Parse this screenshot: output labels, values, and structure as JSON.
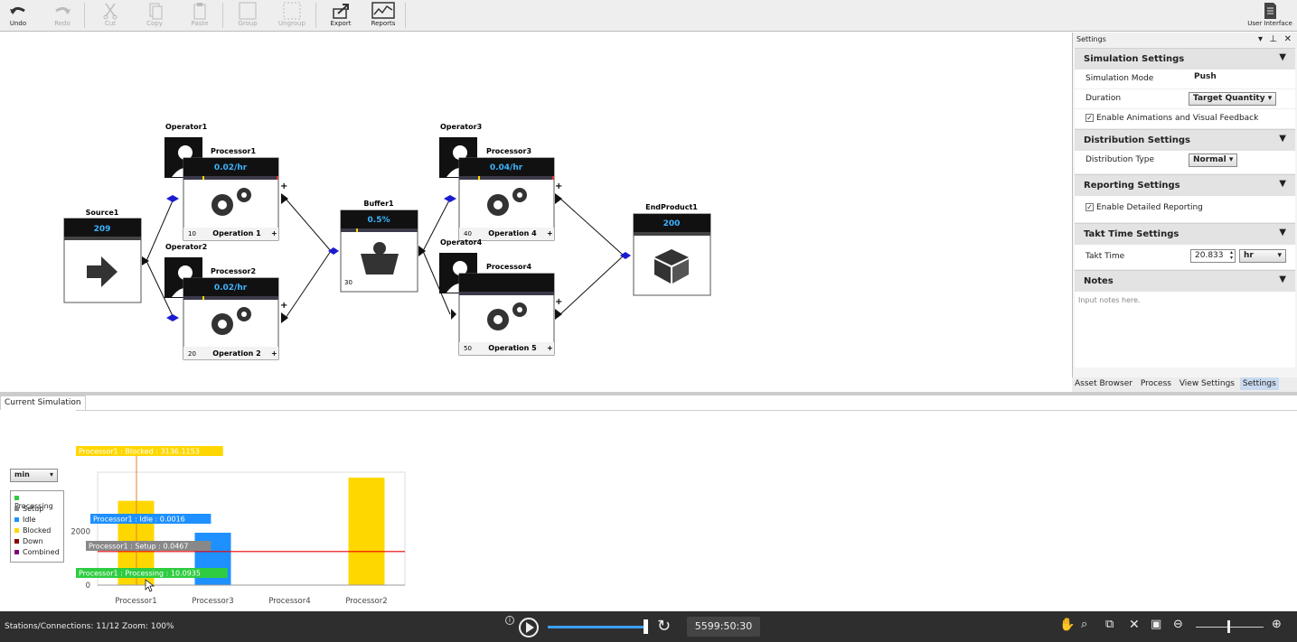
{
  "toolbar": {
    "undo": "Undo",
    "redo": "Redo",
    "cut": "Cut",
    "copy": "Copy",
    "paste": "Paste",
    "group": "Group",
    "ungroup": "Ungroup",
    "export": "Export",
    "reports": "Reports",
    "user_interface": "User Interface"
  },
  "canvas": {
    "source": {
      "name": "Source1",
      "value": "209"
    },
    "operator1": "Operator1",
    "operator2": "Operator2",
    "operator3": "Operator3",
    "operator4": "Operator4",
    "processor1": {
      "name": "Processor1",
      "rate": "0.02/hr",
      "count": "10",
      "op": "Operation 1"
    },
    "processor2": {
      "name": "Processor2",
      "rate": "0.02/hr",
      "count": "20",
      "op": "Operation 2"
    },
    "processor3": {
      "name": "Processor3",
      "rate": "0.04/hr",
      "count": "40",
      "op": "Operation 4"
    },
    "processor4": {
      "name": "Processor4",
      "rate": "",
      "count": "50",
      "op": "Operation 5"
    },
    "buffer": {
      "name": "Buffer1",
      "value": "0.5%",
      "count": "30"
    },
    "endproduct": {
      "name": "EndProduct1",
      "value": "200"
    },
    "plus": "+"
  },
  "settings": {
    "panel_title": "Settings",
    "simulation": {
      "title": "Simulation Settings",
      "mode_label": "Simulation Mode",
      "mode_value": "Push",
      "duration_label": "Duration",
      "duration_value": "Target Quantity",
      "anim_label": "Enable Animations and Visual Feedback"
    },
    "distribution": {
      "title": "Distribution Settings",
      "type_label": "Distribution Type",
      "type_value": "Normal"
    },
    "reporting": {
      "title": "Reporting Settings",
      "detail_label": "Enable Detailed Reporting"
    },
    "takt": {
      "title": "Takt Time Settings",
      "label": "Takt Time",
      "value": "20.833",
      "unit": "hr"
    },
    "notes": {
      "title": "Notes",
      "placeholder": "Input notes here."
    }
  },
  "panel_tabs": [
    "Asset Browser",
    "Process",
    "View Settings",
    "Settings"
  ],
  "bottom": {
    "tab": "Current Simulation",
    "unit_select": "min",
    "legend": [
      {
        "label": "Processing",
        "color": "#2ecc40"
      },
      {
        "label": "Setup",
        "color": "#888888"
      },
      {
        "label": "Idle",
        "color": "#1e90ff"
      },
      {
        "label": "Blocked",
        "color": "#ffd700"
      },
      {
        "label": "Down",
        "color": "#8b0000"
      },
      {
        "label": "Combined",
        "color": "#800080"
      }
    ],
    "tooltips": {
      "blocked": "Processor1 : Blocked : 3136.1153",
      "idle": "Processor1 : Idle : 0.0016",
      "setup": "Processor1 : Setup : 0.0467",
      "processing": "Processor1 : Processing : 10.0935"
    }
  },
  "chart_data": {
    "type": "bar",
    "categories": [
      "Processor1",
      "Processor3",
      "Processor4",
      "Processor2"
    ],
    "series": [
      {
        "name": "Blocked",
        "color": "#ffd700",
        "values": [
          3136.1153,
          0,
          0,
          4000
        ]
      },
      {
        "name": "Idle",
        "color": "#1e90ff",
        "values": [
          0.0016,
          1950,
          0,
          0
        ]
      }
    ],
    "yticks": [
      "0",
      "2000"
    ],
    "ylim": [
      0,
      4200
    ],
    "takt_line": 1250
  },
  "status": {
    "left": "Stations/Connections: 11/12  Zoom: 100%",
    "time": "5599:50:30",
    "info": "i"
  }
}
